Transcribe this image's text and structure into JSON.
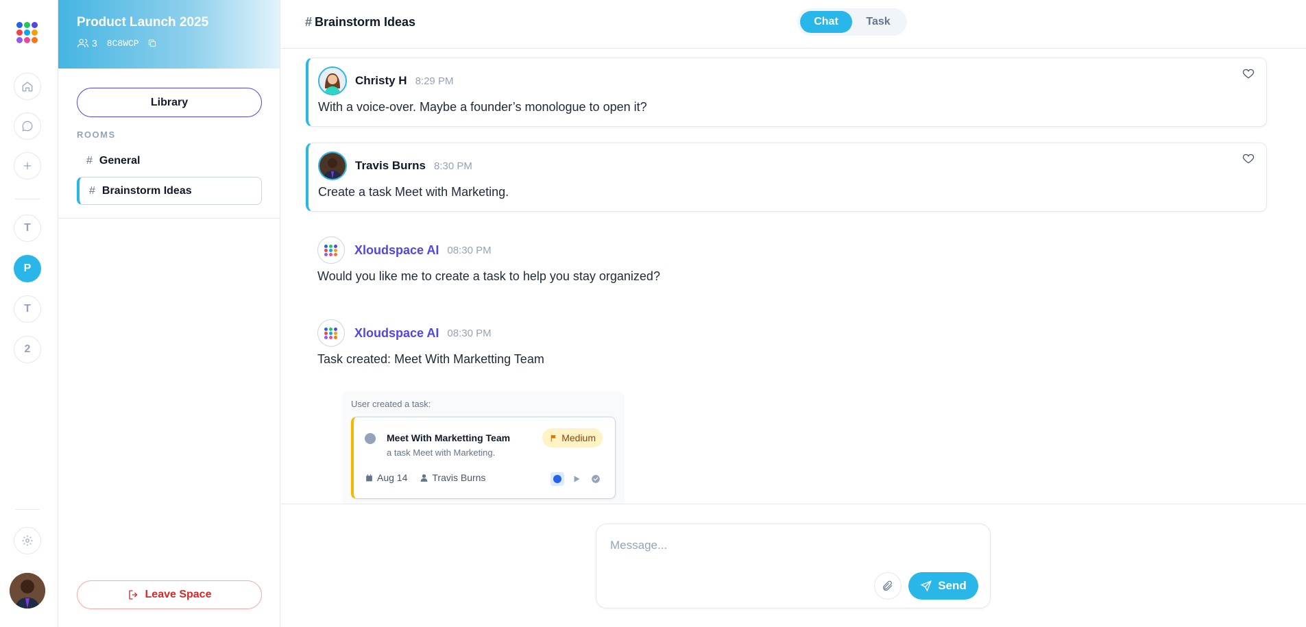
{
  "rail": {
    "logo_colors": [
      "#2563eb",
      "#22c55e",
      "#4f46e5",
      "#ef4444",
      "#0ea5e9",
      "#f59e0b",
      "#8b5cf6",
      "#ec4899",
      "#f97316"
    ],
    "spaces": [
      {
        "label": "T",
        "active": false
      },
      {
        "label": "P",
        "active": true
      },
      {
        "label": "T",
        "active": false
      },
      {
        "label": "2",
        "active": false
      }
    ]
  },
  "space": {
    "title": "Product Launch 2025",
    "member_count": "3",
    "code": "8C8WCP",
    "library_label": "Library",
    "rooms_label": "ROOMS",
    "rooms": [
      {
        "hash": "#",
        "name": "General",
        "active": false
      },
      {
        "hash": "#",
        "name": "Brainstorm Ideas",
        "active": true
      }
    ],
    "leave_label": "Leave Space"
  },
  "header": {
    "hash": "#",
    "room_title": "Brainstorm Ideas",
    "tabs": [
      {
        "label": "Chat",
        "active": true
      },
      {
        "label": "Task",
        "active": false
      }
    ]
  },
  "messages": [
    {
      "name": "Christy H",
      "time": "8:29 PM",
      "text": "With a voice-over. Maybe a founder’s monologue to open it?"
    },
    {
      "name": "Travis Burns",
      "time": "8:30 PM",
      "text": "Create a task Meet with Marketing."
    }
  ],
  "ai_messages": [
    {
      "name": "Xloudspace AI",
      "time": "08:30 PM",
      "text": "Would you like me to create a task to help you stay organized?"
    },
    {
      "name": "Xloudspace AI",
      "time": "08:30 PM",
      "text_prefix": "Task created:",
      "text_value": "Meet With Marketting Team"
    }
  ],
  "task_card": {
    "caption": "User created a task:",
    "title": "Meet With Marketting Team",
    "description": "a task Meet with Marketing.",
    "priority": "Medium",
    "date": "Aug 14",
    "assignee": "Travis Burns"
  },
  "composer": {
    "placeholder": "Message...",
    "send_label": "Send"
  },
  "colors": {
    "accent": "#29b6e8",
    "ai_name": "#4f46e5",
    "danger": "#dc2626",
    "priority_bg": "#fdf3c4"
  }
}
